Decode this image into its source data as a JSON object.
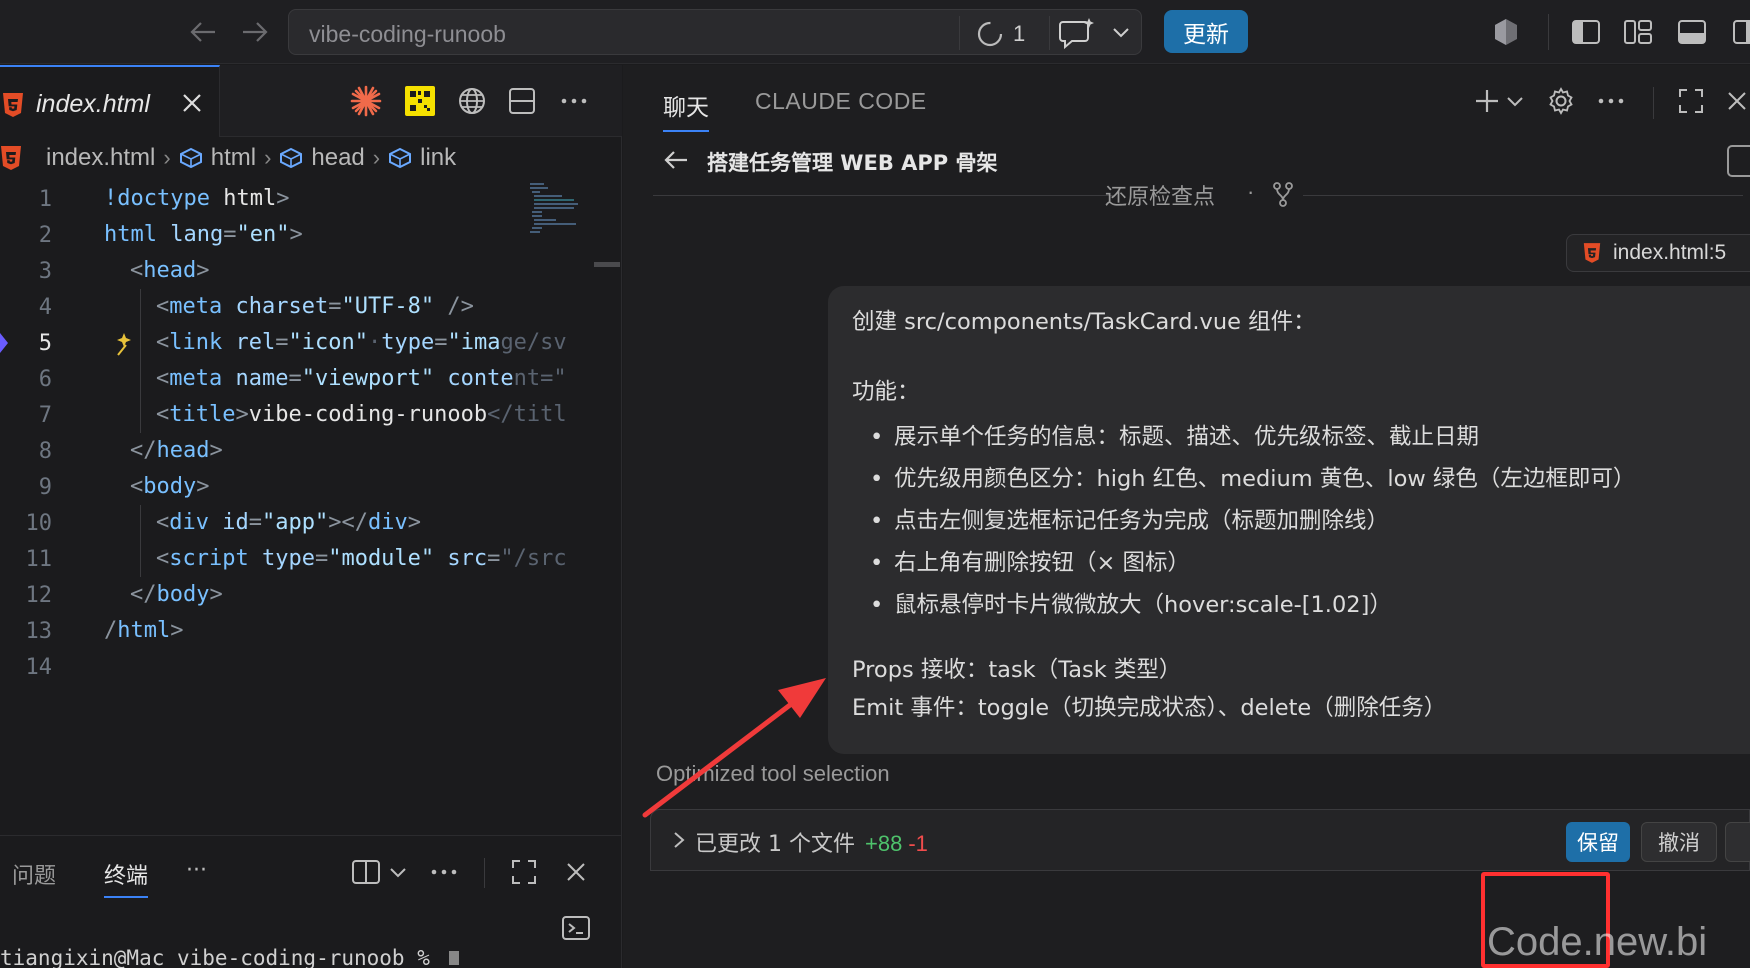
{
  "topbar": {
    "project_title": "vibe-coding-runoob",
    "progress_count": "1",
    "update_label": "更新"
  },
  "editor": {
    "tab_label": "index.html",
    "breadcrumb": [
      "index.html",
      "html",
      "head",
      "link"
    ],
    "lines": [
      {
        "n": "1",
        "indent": 0,
        "parts": [
          [
            "t-tag",
            "!doctype "
          ],
          [
            "t-txt",
            "html"
          ],
          [
            "t-punc",
            ">"
          ]
        ]
      },
      {
        "n": "2",
        "indent": 0,
        "parts": [
          [
            "t-tag",
            "html "
          ],
          [
            "t-attr",
            "lang"
          ],
          [
            "t-punc",
            "="
          ],
          [
            "t-str",
            "\"en\""
          ],
          [
            "t-punc",
            ">"
          ]
        ]
      },
      {
        "n": "3",
        "indent": 1,
        "parts": [
          [
            "t-punc",
            "<"
          ],
          [
            "t-tag",
            "head"
          ],
          [
            "t-punc",
            ">"
          ]
        ]
      },
      {
        "n": "4",
        "indent": 2,
        "parts": [
          [
            "t-punc",
            "<"
          ],
          [
            "t-tag",
            "meta "
          ],
          [
            "t-attr",
            "charset"
          ],
          [
            "t-punc",
            "="
          ],
          [
            "t-str",
            "\"UTF-8\""
          ],
          [
            "t-punc",
            " />"
          ]
        ]
      },
      {
        "n": "5",
        "indent": 2,
        "parts": [
          [
            "t-punc",
            "<"
          ],
          [
            "t-tag",
            "link "
          ],
          [
            "t-attr",
            "rel"
          ],
          [
            "t-punc",
            "="
          ],
          [
            "t-str",
            "\"icon\""
          ],
          [
            "t-dim",
            "·"
          ],
          [
            "t-attr",
            "type"
          ],
          [
            "t-punc",
            "="
          ],
          [
            "t-str",
            "\"ima"
          ],
          [
            "t-dim",
            "ge/sv"
          ]
        ]
      },
      {
        "n": "6",
        "indent": 2,
        "parts": [
          [
            "t-punc",
            "<"
          ],
          [
            "t-tag",
            "meta "
          ],
          [
            "t-attr",
            "name"
          ],
          [
            "t-punc",
            "="
          ],
          [
            "t-str",
            "\"viewport\" "
          ],
          [
            "t-attr",
            "conte"
          ],
          [
            "t-dim",
            "nt=\""
          ]
        ]
      },
      {
        "n": "7",
        "indent": 2,
        "parts": [
          [
            "t-punc",
            "<"
          ],
          [
            "t-tag",
            "title"
          ],
          [
            "t-punc",
            ">"
          ],
          [
            "t-txt",
            "vibe-coding-runoob"
          ],
          [
            "t-dim",
            "</titl"
          ]
        ]
      },
      {
        "n": "8",
        "indent": 1,
        "parts": [
          [
            "t-punc",
            "</"
          ],
          [
            "t-tag",
            "head"
          ],
          [
            "t-punc",
            ">"
          ]
        ]
      },
      {
        "n": "9",
        "indent": 1,
        "parts": [
          [
            "t-punc",
            "<"
          ],
          [
            "t-tag",
            "body"
          ],
          [
            "t-punc",
            ">"
          ]
        ]
      },
      {
        "n": "10",
        "indent": 2,
        "parts": [
          [
            "t-punc",
            "<"
          ],
          [
            "t-tag",
            "div "
          ],
          [
            "t-attr",
            "id"
          ],
          [
            "t-punc",
            "="
          ],
          [
            "t-str",
            "\"app\""
          ],
          [
            "t-punc",
            "></"
          ],
          [
            "t-tag",
            "div"
          ],
          [
            "t-punc",
            ">"
          ]
        ]
      },
      {
        "n": "11",
        "indent": 2,
        "parts": [
          [
            "t-punc",
            "<"
          ],
          [
            "t-tag",
            "script "
          ],
          [
            "t-attr",
            "type"
          ],
          [
            "t-punc",
            "="
          ],
          [
            "t-str",
            "\"module\" "
          ],
          [
            "t-attr",
            "src"
          ],
          [
            "t-punc",
            "="
          ],
          [
            "t-dim",
            "\"/src"
          ]
        ]
      },
      {
        "n": "12",
        "indent": 1,
        "parts": [
          [
            "t-punc",
            "</"
          ],
          [
            "t-tag",
            "body"
          ],
          [
            "t-punc",
            ">"
          ]
        ]
      },
      {
        "n": "13",
        "indent": 0,
        "parts": [
          [
            "t-punc",
            "/"
          ],
          [
            "t-tag",
            "html"
          ],
          [
            "t-punc",
            ">"
          ]
        ]
      },
      {
        "n": "14",
        "indent": 0,
        "parts": []
      }
    ],
    "current_line": "5"
  },
  "panel": {
    "tab_problems": "问题",
    "tab_terminal": "终端",
    "more": "···",
    "terminal_prompt": "tiangixin@Mac vibe-coding-runoob %"
  },
  "chat": {
    "tab_chat": "聊天",
    "tab_claude_code": "CLAUDE CODE",
    "conversation_title": "搭建任务管理 WEB APP 骨架",
    "checkpoint_label": "还原检查点",
    "checkpoint_dot": "·",
    "file_chip": "index.html:5",
    "message": {
      "intro": "创建 src/components/TaskCard.vue 组件：",
      "features_label": "功能：",
      "features": [
        "展示单个任务的信息：标题、描述、优先级标签、截止日期",
        "优先级用颜色区分：high 红色、medium 黄色、low 绿色（左边框即可）",
        "点击左侧复选框标记任务为完成（标题加删除线）",
        "右上角有删除按钮（× 图标）",
        "鼠标悬停时卡片微微放大（hover:scale-[1.02]）"
      ],
      "props": "Props 接收：task（Task 类型）",
      "emit": "Emit 事件：toggle（切换完成状态）、delete（删除任务）"
    },
    "tool_selection": "Optimized tool selection",
    "changes": {
      "text": "已更改 1 个文件",
      "added": "+88",
      "removed": "-1",
      "keep_label": "保留",
      "undo_label": "撤消"
    }
  },
  "watermark": "Code.new.bi",
  "colors": {
    "accent": "#1e6fa8",
    "tab_underline": "#3b82f6",
    "highlight_red": "#ff3030",
    "added_green": "#4ec26b",
    "removed_red": "#f14c4c"
  }
}
